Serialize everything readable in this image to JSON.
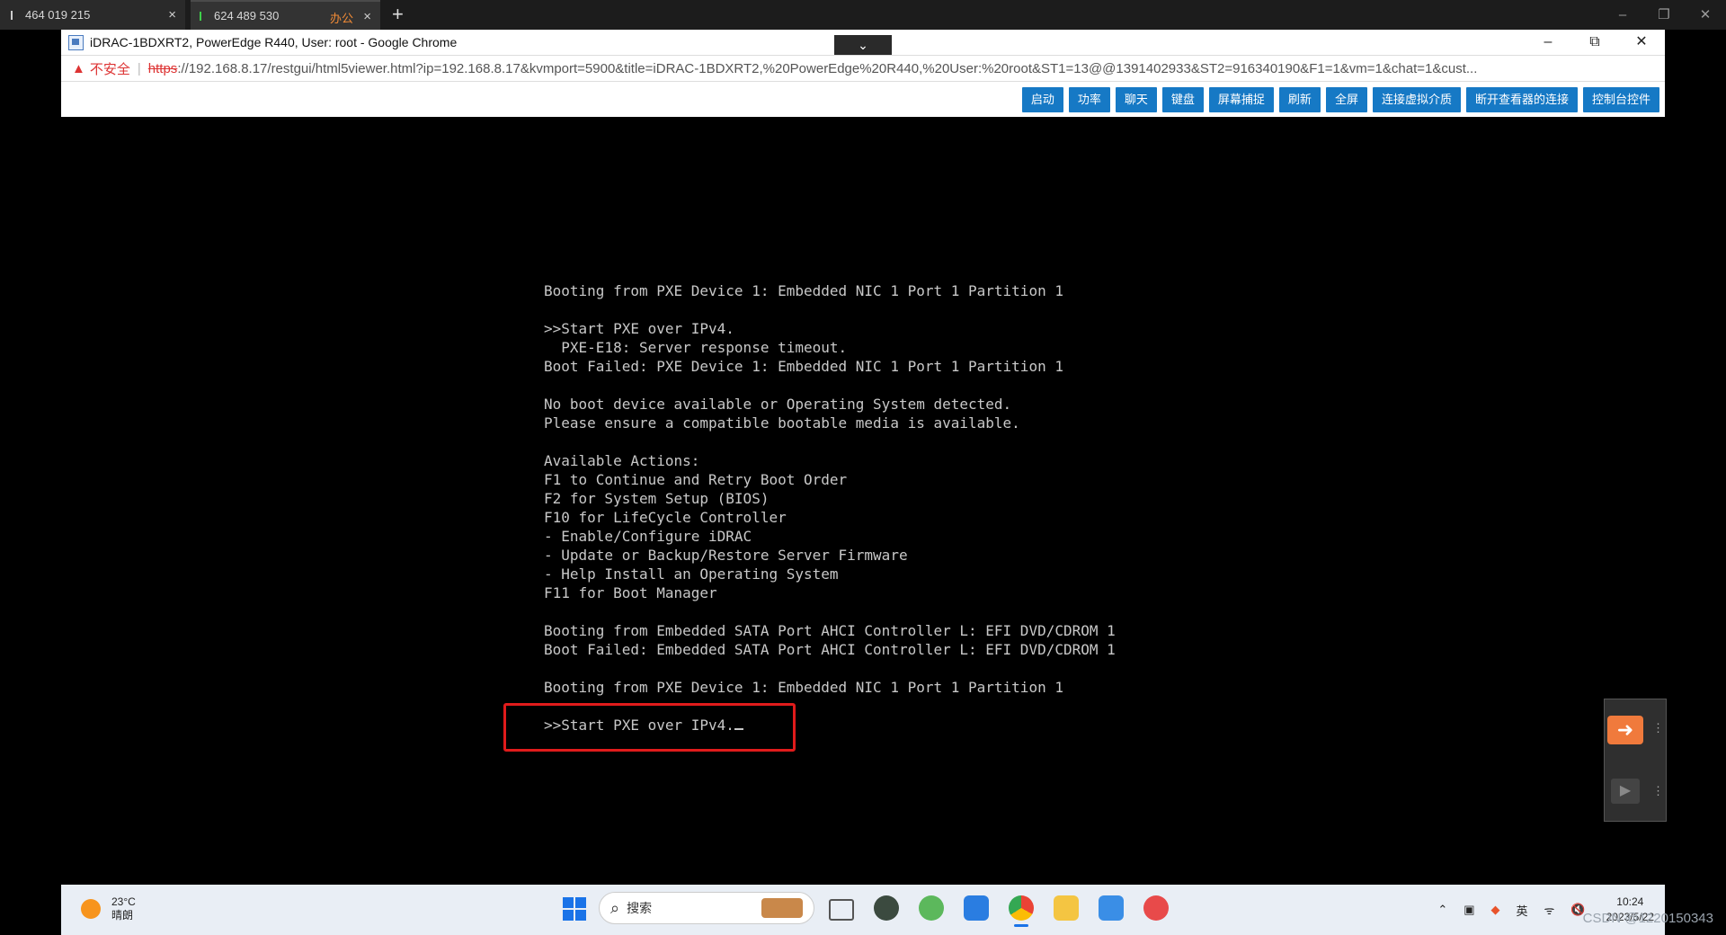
{
  "remote_tabs": [
    {
      "label": "464 019 215",
      "close": "×"
    },
    {
      "label": "624 489 530",
      "group": "办公",
      "close": "×"
    }
  ],
  "new_tab_symbol": "+",
  "browser": {
    "title": "iDRAC-1BDXRT2, PowerEdge R440, User: root - Google Chrome",
    "collapse_symbol": "⌄",
    "controls": {
      "minimize": "–",
      "restore": "⧉",
      "close": "✕"
    },
    "address": {
      "warning_label": "不安全",
      "scheme": "https",
      "rest": "://192.168.8.17/restgui/html5viewer.html?ip=192.168.8.17&kvmport=5900&title=iDRAC-1BDXRT2,%20PowerEdge%20R440,%20User:%20root&ST1=13@@1391402933&ST2=916340190&F1=1&vm=1&chat=1&cust..."
    }
  },
  "toolbar_buttons": [
    "启动",
    "功率",
    "聊天",
    "键盘",
    "屏幕捕捉",
    "刷新",
    "全屏",
    "连接虚拟介质",
    "断开查看器的连接",
    "控制台控件"
  ],
  "console_lines": [
    "Booting from PXE Device 1: Embedded NIC 1 Port 1 Partition 1",
    "",
    ">>Start PXE over IPv4.",
    "  PXE-E18: Server response timeout.",
    "Boot Failed: PXE Device 1: Embedded NIC 1 Port 1 Partition 1",
    "",
    "No boot device available or Operating System detected.",
    "Please ensure a compatible bootable media is available.",
    "",
    "Available Actions:",
    "F1 to Continue and Retry Boot Order",
    "F2 for System Setup (BIOS)",
    "F10 for LifeCycle Controller",
    "- Enable/Configure iDRAC",
    "- Update or Backup/Restore Server Firmware",
    "- Help Install an Operating System",
    "F11 for Boot Manager",
    "",
    "Booting from Embedded SATA Port AHCI Controller L: EFI DVD/CDROM 1",
    "Boot Failed: Embedded SATA Port AHCI Controller L: EFI DVD/CDROM 1",
    "",
    "Booting from PXE Device 1: Embedded NIC 1 Port 1 Partition 1",
    "",
    ">>Start PXE over IPv4."
  ],
  "taskbar": {
    "weather_temp": "23°C",
    "weather_desc": "晴朗",
    "search_placeholder": "搜索",
    "ime": "英",
    "time": "10:24",
    "date": "2023/5/22"
  },
  "watermark": "CSDN @1220150343",
  "colors": {
    "accent": "#1679c5",
    "highlight": "#e01b1b",
    "warning": "#d33333"
  }
}
